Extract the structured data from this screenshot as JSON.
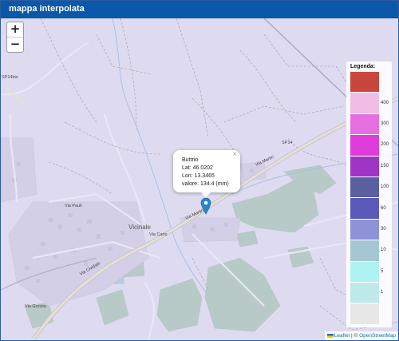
{
  "window": {
    "title": "mappa interpolata"
  },
  "zoom": {
    "in_label": "+",
    "out_label": "−"
  },
  "popup": {
    "close_label": "×",
    "station": "Buttrio",
    "lat": "Lat: 46.0202",
    "lon": "Lon: 13.3465",
    "value": "valore: 134.4 (mm)"
  },
  "map_labels": {
    "sp14bis": "SP14bis",
    "sp14": "SP14",
    "via_martiri": "Via Martiri",
    "via_martiri2": "Via Martiri",
    "vicinale": "Vicinale",
    "via_carlo": "Via Carlo",
    "via_cividale": "Via Cividale",
    "via_pauli": "Via Pauli",
    "via_gorizia": "Via Gorizia"
  },
  "legend": {
    "title": "Legenda:",
    "items": [
      {
        "label": "",
        "color": "#c9463d"
      },
      {
        "label": "400",
        "color": "#f0bde6"
      },
      {
        "label": "300",
        "color": "#e56fe0"
      },
      {
        "label": "200",
        "color": "#de3ddc"
      },
      {
        "label": "150",
        "color": "#a034c4"
      },
      {
        "label": "100",
        "color": "#5a5fa0"
      },
      {
        "label": "60",
        "color": "#5959b9"
      },
      {
        "label": "30",
        "color": "#8f92d6"
      },
      {
        "label": "10",
        "color": "#a5c7d3"
      },
      {
        "label": "5",
        "color": "#aef2f2"
      },
      {
        "label": "1",
        "color": "#bde9e9"
      },
      {
        "label": "",
        "color": "#e7e7e7"
      }
    ]
  },
  "attribution": {
    "leaflet": "Leaflet",
    "sep": " | © ",
    "osm": "OpenStreetMap"
  },
  "colors": {
    "titlebar": "#0b58a8",
    "marker": "#2b82cb",
    "overlay": "#cfc9ee"
  }
}
